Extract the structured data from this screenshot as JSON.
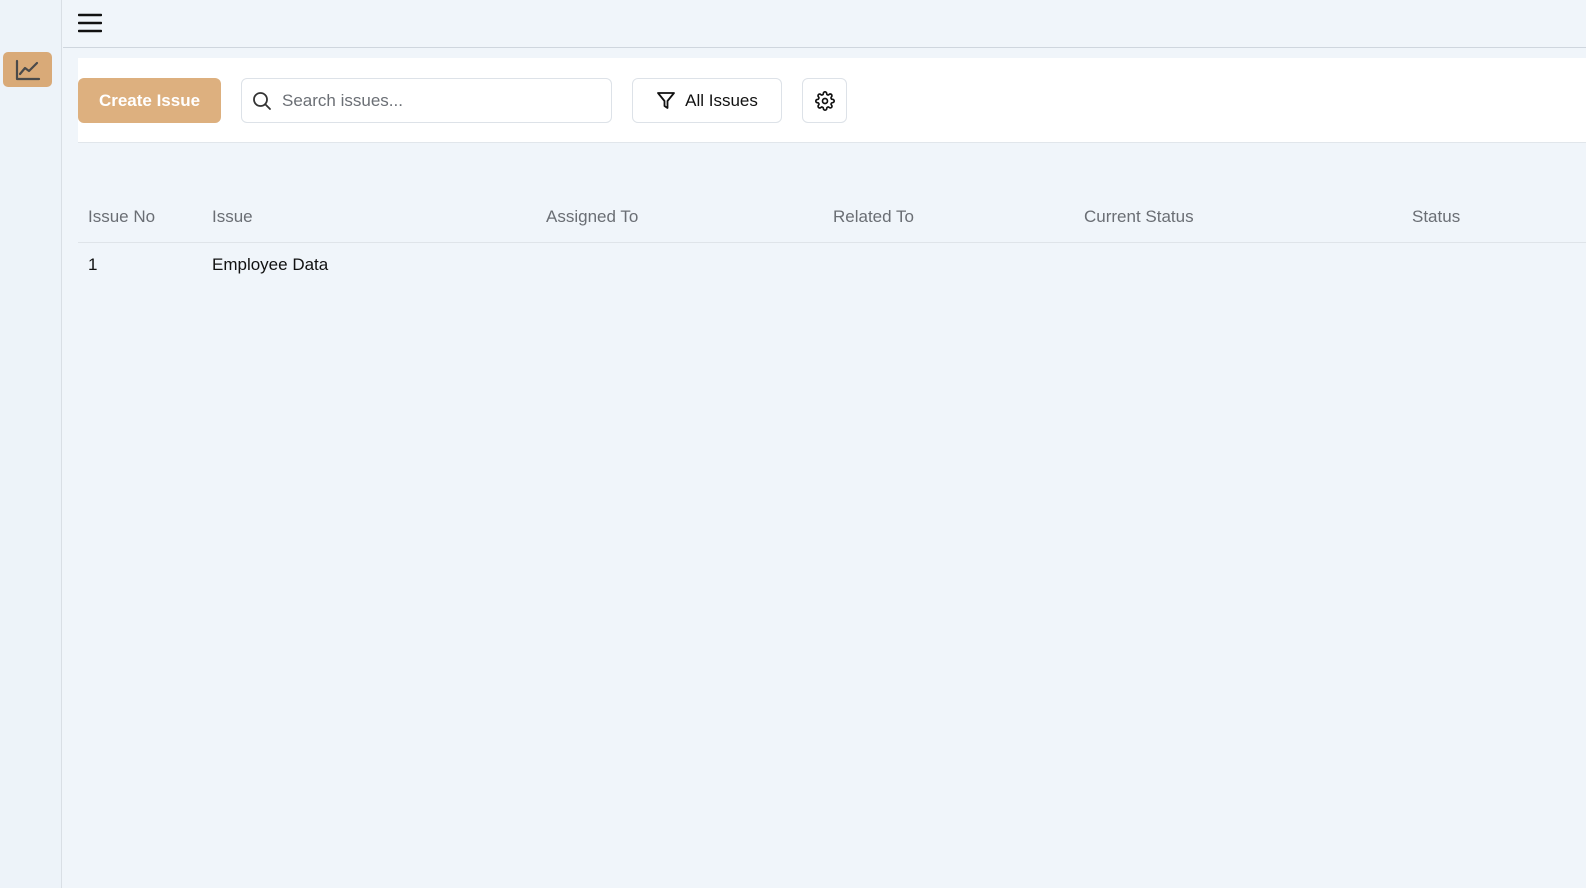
{
  "sidebar": {
    "items": [
      {
        "icon": "line-chart-icon",
        "active": true,
        "color": "#d9aa78"
      }
    ]
  },
  "topbar": {
    "menu_icon": "hamburger-menu-icon"
  },
  "toolbar": {
    "create_label": "Create Issue",
    "search_placeholder": "Search issues...",
    "filter_label": "All Issues",
    "settings_icon": "gear-icon"
  },
  "table": {
    "columns": [
      "Issue No",
      "Issue",
      "Assigned To",
      "Related To",
      "Current Status",
      "Status"
    ],
    "rows": [
      {
        "issue_no": "1",
        "issue": "Employee Data",
        "assigned_to": "",
        "related_to": "",
        "current_status": "",
        "status": ""
      }
    ]
  },
  "colors": {
    "accent": "#ddb07f",
    "background": "#f0f5fa"
  }
}
